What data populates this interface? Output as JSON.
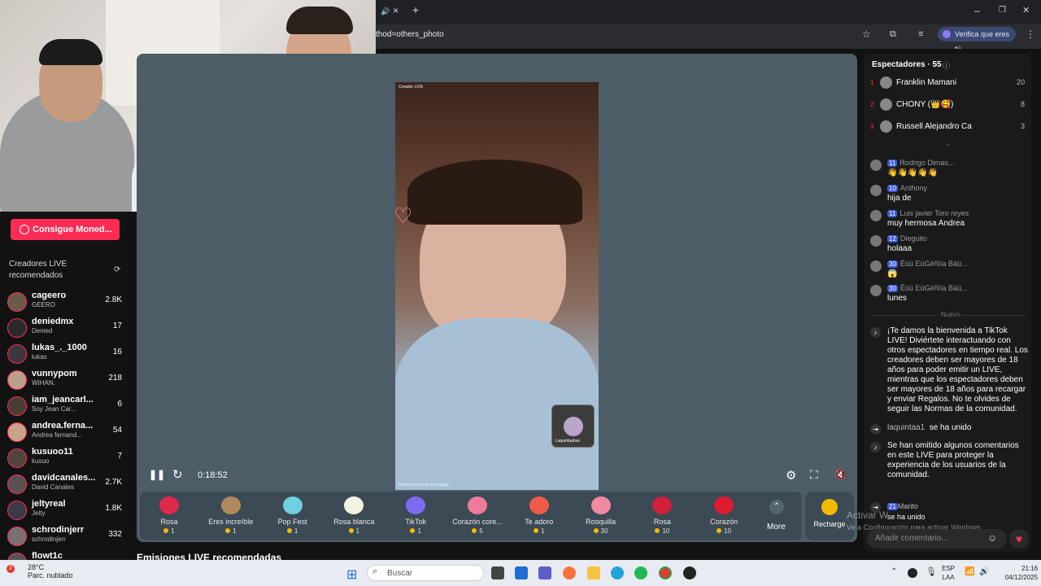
{
  "browser": {
    "url": "thod=others_photo",
    "verify_label": "Verifica que eres tú",
    "tab_close": "×",
    "new_tab": "+",
    "window_min": "–",
    "window_max": "❐",
    "window_close": "✕"
  },
  "sidebar": {
    "coins_button": "Consigue Moned...",
    "creators_title": "Creadores LIVE recomendados",
    "creators": [
      {
        "name": "cageero",
        "sub": "GEERO",
        "count": "2.8K"
      },
      {
        "name": "deniedmx",
        "sub": "Denied",
        "count": "17"
      },
      {
        "name": "lukas_._1000",
        "sub": "lukas",
        "count": "16"
      },
      {
        "name": "vunnypom",
        "sub": "WIHAN.",
        "count": "218"
      },
      {
        "name": "iam_jeancarl...",
        "sub": "Soy Jean Car...",
        "count": "6"
      },
      {
        "name": "andrea.ferna...",
        "sub": "Andrea fernand...",
        "count": "54"
      },
      {
        "name": "kusuoo11",
        "sub": "kusuo",
        "count": "7"
      },
      {
        "name": "davidcanales...",
        "sub": "David Canales",
        "count": "2.7K"
      },
      {
        "name": "jeltyreal",
        "sub": "Jelty",
        "count": "1.8K"
      },
      {
        "name": "schrodinjerr",
        "sub": "schrodinjerr",
        "count": "332"
      },
      {
        "name": "flowt1c",
        "sub": "",
        "count": ""
      }
    ]
  },
  "player": {
    "time": "0:18:52",
    "pip_name": "Laquintaahes",
    "video_label": "Creador LIVE",
    "video_footer": "Andrea fernanda Artundaga"
  },
  "gifts": [
    {
      "name": "Rosa",
      "price": "1",
      "color": "#e0294a"
    },
    {
      "name": "Eres increíble",
      "price": "1",
      "color": "#b08a5e"
    },
    {
      "name": "Pop Fest",
      "price": "1",
      "color": "#6fd0e0"
    },
    {
      "name": "Rosa blanca",
      "price": "1",
      "color": "#f2f2e0"
    },
    {
      "name": "TikTok",
      "price": "1",
      "color": "#7b6cf0"
    },
    {
      "name": "Corazón core...",
      "price": "5",
      "color": "#f07a9a"
    },
    {
      "name": "Te adoro",
      "price": "1",
      "color": "#f05a4a"
    },
    {
      "name": "Rosquilla",
      "price": "30",
      "color": "#f08aa0"
    },
    {
      "name": "Rosa",
      "price": "10",
      "color": "#d0203a"
    },
    {
      "name": "Corazón",
      "price": "10",
      "color": "#e01a30"
    }
  ],
  "more_label": "More",
  "recharge_label": "Recharge",
  "recommended_title": "Emisiones LIVE recomendadas",
  "viewers": {
    "title": "Espectadores · 55",
    "list": [
      {
        "rank": "1",
        "name": "Franklin Mamani",
        "score": "20"
      },
      {
        "rank": "2",
        "name": "CHONY (👑🥰)",
        "score": "8"
      },
      {
        "rank": "3",
        "name": "Russell Alejandro Ca",
        "score": "3"
      }
    ]
  },
  "comments": [
    {
      "level": "11",
      "user": "Rodrigo Dimas...",
      "text": "👋👋👋👋👋"
    },
    {
      "level": "10",
      "user": "Anthony",
      "text": "hija de"
    },
    {
      "level": "11",
      "user": "Luis javier Toro reyes",
      "text": "muy hermosa Andrea"
    },
    {
      "level": "12",
      "user": "Dieguito",
      "text": "holaaa"
    },
    {
      "level": "30",
      "user": "Ëüü EüGëñïïa Bäü...",
      "text": "😱"
    },
    {
      "level": "30",
      "user": "Ëüü EüGëñïïa Bäü...",
      "text": "lunes"
    }
  ],
  "new_label": "Nuevo",
  "system_messages": {
    "welcome": "¡Te damos la bienvenida a TikTok LIVE! Diviértete interactuando con otros espectadores en tiempo real. Los creadores deben ser mayores de 18 años para poder emitir un LIVE, mientras que los espectadores deben ser mayores de 18 años para recargar y enviar Regalos. No te olvides de seguir las Normas de la comunidad.",
    "join_user": "laquintaa1",
    "join_text": "se ha unido",
    "omitted": "Se han omitido algunos comentarios en este LIVE para proteger la experiencia de los usuarios de la comunidad.",
    "last_level": "21",
    "last_user": "Marito",
    "last_text": "se ha unido"
  },
  "comment_placeholder": "Añadir comentario...",
  "windows_activation": {
    "line1": "Activar W",
    "line2": "Ve a Configuración para activar Windows."
  },
  "taskbar": {
    "weather_temp": "28°C",
    "weather_desc": "Parc. nublado",
    "search_placeholder": "Buscar",
    "lang1": "ESP",
    "lang2": "LAA",
    "time": "21:16",
    "date": "04/12/2025",
    "badge": "2"
  }
}
